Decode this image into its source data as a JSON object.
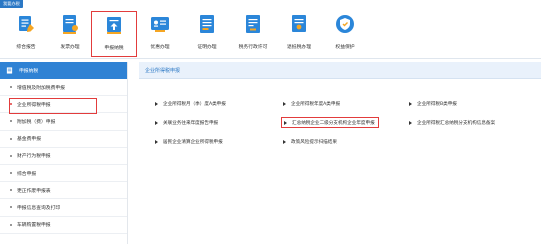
{
  "top_tag": "我要办税",
  "toolbar": {
    "items": [
      {
        "label": "综合报告",
        "icon": "report-icon",
        "active": false
      },
      {
        "label": "发票办理",
        "icon": "invoice-icon",
        "active": false
      },
      {
        "label": "申报纳税",
        "icon": "tax-declare-icon",
        "active": true
      },
      {
        "label": "优惠办理",
        "icon": "discount-icon",
        "active": false
      },
      {
        "label": "证明办理",
        "icon": "certificate-icon",
        "active": false
      },
      {
        "label": "税务行政许可",
        "icon": "license-icon",
        "active": false
      },
      {
        "label": "退抵税办理",
        "icon": "refund-icon",
        "active": false
      },
      {
        "label": "权益保护",
        "icon": "shield-icon",
        "active": false
      }
    ]
  },
  "sidebar": {
    "title": "申报纳税",
    "items": [
      {
        "label": "增值税及附加税费申报",
        "selected": false
      },
      {
        "label": "企业所得税申报",
        "selected": true
      },
      {
        "label": "附加税（费）申报",
        "selected": false
      },
      {
        "label": "基金费申报",
        "selected": false
      },
      {
        "label": "财产行为税申报",
        "selected": false
      },
      {
        "label": "综合申报",
        "selected": false
      },
      {
        "label": "更正作废申报表",
        "selected": false
      },
      {
        "label": "申报信息查询及打印",
        "selected": false
      },
      {
        "label": "车辆购置税申报",
        "selected": false
      }
    ]
  },
  "main": {
    "title": "企业所得税申报",
    "links": [
      {
        "label": "企业所得税月（季）度A类申报",
        "boxed": false
      },
      {
        "label": "企业所得税年度A类申报",
        "boxed": false
      },
      {
        "label": "企业所得税B类申报",
        "boxed": false
      },
      {
        "label": "关联业务往来年度报告申报",
        "boxed": false
      },
      {
        "label": "汇总纳税企业二级分支机构企业年度申报",
        "boxed": true
      },
      {
        "label": "企业所得税汇总纳税分支机构信息备案",
        "boxed": false
      },
      {
        "label": "居民企业清算企业所得税申报",
        "boxed": false
      },
      {
        "label": "政策风险提示扫描结果",
        "boxed": false
      }
    ]
  },
  "colors": {
    "accent": "#2f82d4",
    "highlight_border": "#e23c3c",
    "icon_blue": "#2b86d9"
  }
}
